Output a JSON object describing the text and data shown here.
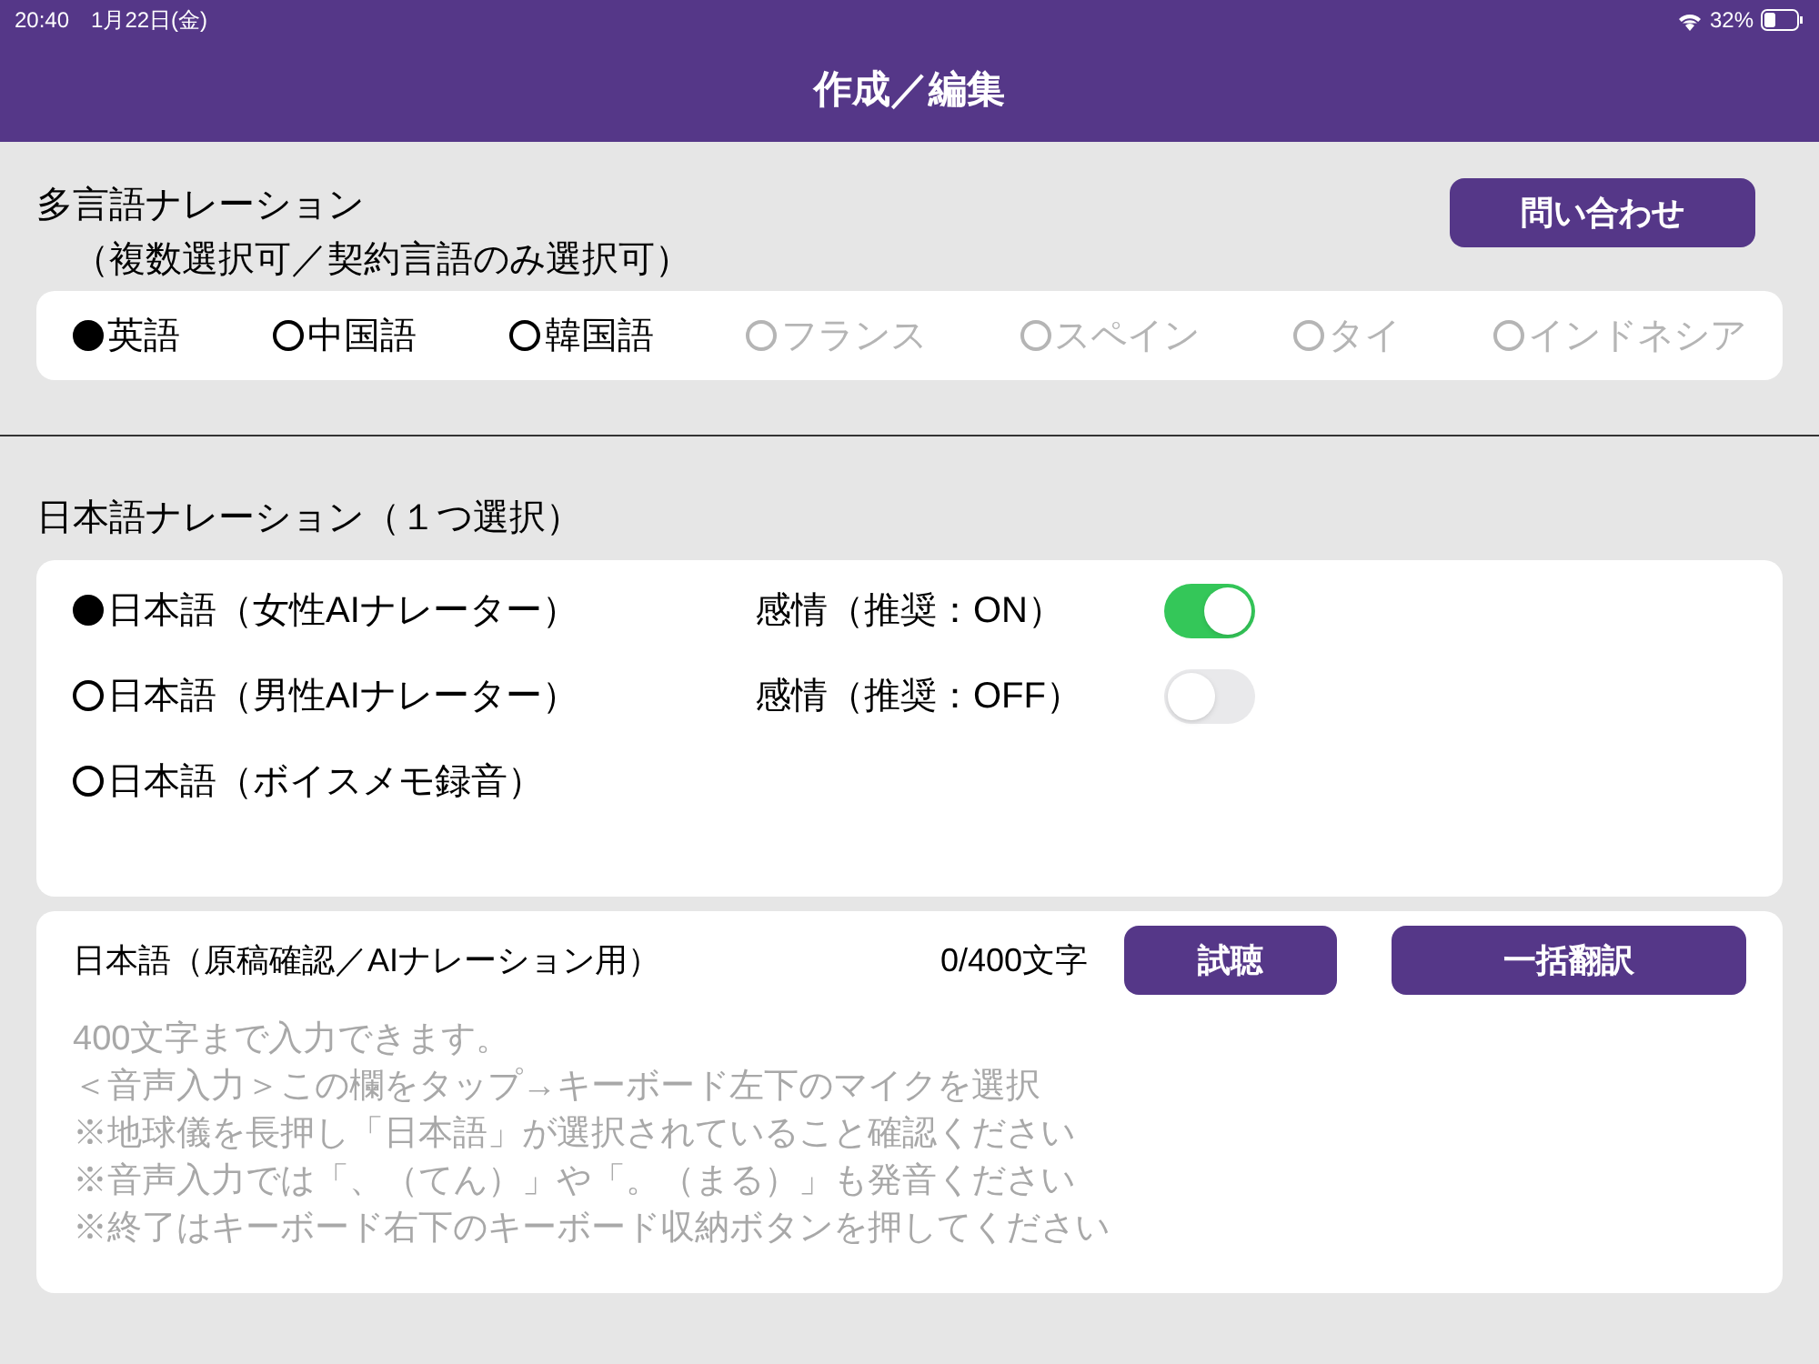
{
  "status_bar": {
    "time": "20:40",
    "date": "1月22日(金)",
    "battery": "32%"
  },
  "header": {
    "title": "作成／編集"
  },
  "multilingual": {
    "title": "多言語ナレーション",
    "subtitle": "（複数選択可／契約言語のみ選択可）",
    "contact_button": "問い合わせ",
    "languages": [
      {
        "label": "英語",
        "selected": true,
        "disabled": false
      },
      {
        "label": "中国語",
        "selected": false,
        "disabled": false
      },
      {
        "label": "韓国語",
        "selected": false,
        "disabled": false
      },
      {
        "label": "フランス",
        "selected": false,
        "disabled": true
      },
      {
        "label": "スペイン",
        "selected": false,
        "disabled": true
      },
      {
        "label": "タイ",
        "selected": false,
        "disabled": true
      },
      {
        "label": "インドネシア",
        "selected": false,
        "disabled": true
      }
    ]
  },
  "japanese": {
    "title": "日本語ナレーション（１つ選択）",
    "options": [
      {
        "label": "日本語（女性AIナレーター）",
        "selected": true,
        "emotion_label": "感情（推奨：ON）",
        "emotion_on": true
      },
      {
        "label": "日本語（男性AIナレーター）",
        "selected": false,
        "emotion_label": "感情（推奨：OFF）",
        "emotion_on": false
      },
      {
        "label": "日本語（ボイスメモ録音）",
        "selected": false
      }
    ]
  },
  "script": {
    "label": "日本語（原稿確認／AIナレーション用）",
    "count": "0/400文字",
    "listen_button": "試聴",
    "translate_button": "一括翻訳",
    "placeholder": [
      "400文字まで入力できます。",
      "＜音声入力＞この欄をタップ→キーボード左下のマイクを選択",
      "※地球儀を長押し「日本語」が選択されていること確認ください",
      "※音声入力では「、（てん）」や「。（まる）」も発音ください",
      "※終了はキーボード右下のキーボード収納ボタンを押してください"
    ]
  }
}
